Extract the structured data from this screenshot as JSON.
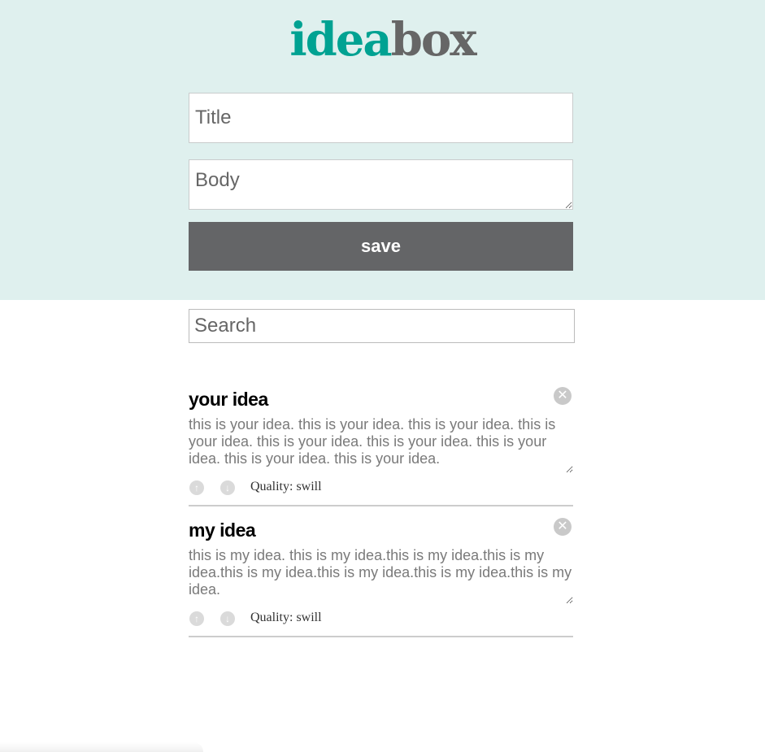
{
  "logo": {
    "part1": "idea",
    "part2": "box"
  },
  "form": {
    "title_placeholder": "Title",
    "body_placeholder": "Body",
    "save_label": "save"
  },
  "search": {
    "placeholder": "Search"
  },
  "ideas": [
    {
      "title": "your idea",
      "body": "this is your idea. this is your idea. this is your idea. this is your idea. this is your idea. this is your idea. this is your idea. this is your idea. this is your idea.",
      "quality": "Quality: swill",
      "delete_glyph": "✕",
      "upvote_glyph": "↑",
      "downvote_glyph": "↓"
    },
    {
      "title": "my idea",
      "body": "this is my idea. this is my idea.this is my idea.this is my idea.this is my idea.this is my idea.this is my idea.this is my idea.",
      "quality": "Quality: swill",
      "delete_glyph": "✕",
      "upvote_glyph": "↑",
      "downvote_glyph": "↓"
    }
  ],
  "colors": {
    "header_bg": "#dff0ee",
    "logo_accent": "#00a292",
    "logo_gray": "#666666",
    "save_bg": "#646567"
  }
}
